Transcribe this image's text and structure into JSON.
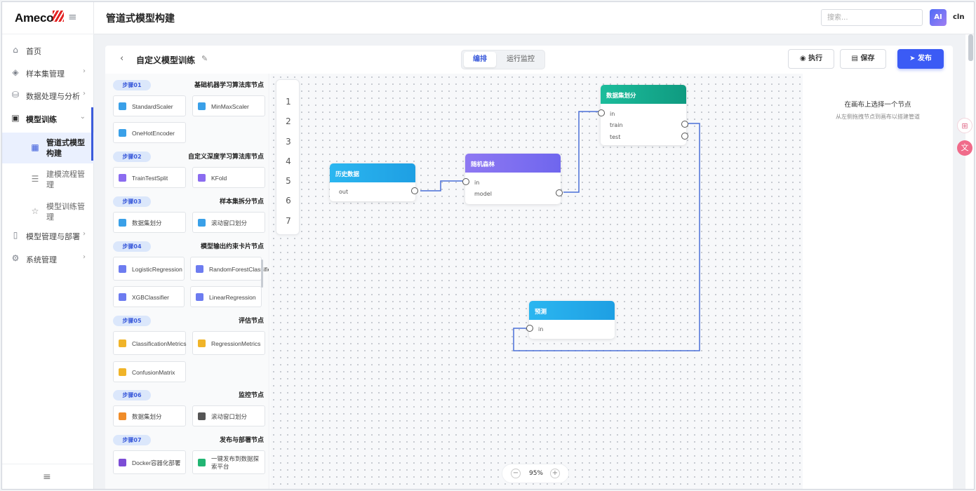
{
  "brand": {
    "name": "Ameco"
  },
  "header": {
    "title": "管道式模型构建",
    "search_placeholder": "搜索...",
    "avatar": "AI",
    "user": "cln"
  },
  "sidebar": {
    "items": [
      {
        "label": "首页",
        "icon": "home-icon"
      },
      {
        "label": "样本集管理",
        "icon": "layers-icon"
      },
      {
        "label": "数据处理与分析",
        "icon": "database-icon"
      },
      {
        "label": "模型训练",
        "icon": "chip-icon"
      },
      {
        "label": "模型管理与部署",
        "icon": "tablet-icon"
      },
      {
        "label": "系统管理",
        "icon": "gear-icon"
      }
    ],
    "sub_items": [
      {
        "label": "管道式模型构建",
        "icon": "grid-icon"
      },
      {
        "label": "建模流程管理",
        "icon": "list-icon"
      },
      {
        "label": "模型训练管理",
        "icon": "star-icon"
      }
    ]
  },
  "toolbar": {
    "title": "自定义模型训练",
    "tabs": [
      "编排",
      "运行监控"
    ],
    "run": "执行",
    "save": "保存",
    "publish": "发布"
  },
  "palette": {
    "groups": [
      {
        "step": "步骤01",
        "title": "基础机器学习算法库节点",
        "nodes": [
          "StandardScaler",
          "MinMaxScaler",
          "OneHotEncoder"
        ]
      },
      {
        "step": "步骤02",
        "title": "自定义深度学习算法库节点",
        "nodes": [
          "TrainTestSplit",
          "KFold"
        ]
      },
      {
        "step": "步骤03",
        "title": "样本集拆分节点",
        "nodes": [
          "数据集划分",
          "滚动窗口划分"
        ]
      },
      {
        "step": "步骤04",
        "title": "模型输出约束卡片节点",
        "nodes": [
          "LogisticRegression",
          "RandomForestClassifier",
          "XGBClassifier",
          "LinearRegression"
        ]
      },
      {
        "step": "步骤05",
        "title": "评估节点",
        "nodes": [
          "ClassificationMetrics",
          "RegressionMetrics",
          "ConfusionMatrix"
        ]
      },
      {
        "step": "步骤06",
        "title": "监控节点",
        "nodes": [
          "数据集划分",
          "滚动窗口划分"
        ]
      },
      {
        "step": "步骤07",
        "title": "发布与部署节点",
        "nodes": [
          "Docker容器化部署",
          "一键发布到数据探索平台"
        ]
      }
    ]
  },
  "canvas": {
    "ruler": [
      "1",
      "2",
      "3",
      "4",
      "5",
      "6",
      "7"
    ],
    "nodes": [
      {
        "title": "历史数据",
        "ports": [
          "out"
        ]
      },
      {
        "title": "随机森林",
        "ports": [
          "in",
          "model"
        ]
      },
      {
        "title": "数据集划分",
        "ports": [
          "in",
          "train",
          "test"
        ]
      },
      {
        "title": "预测",
        "ports": [
          "in"
        ]
      }
    ],
    "zoom": "95%"
  },
  "inspector": {
    "title": "在画布上选择一个节点",
    "hint": "从左侧拖拽节点到画布以搭建管道"
  },
  "colors": {
    "accent": "#3b5bf5",
    "node_blue": "#1fb0ec",
    "node_purple": "#7c6cf0",
    "node_teal": "#14a38a"
  }
}
